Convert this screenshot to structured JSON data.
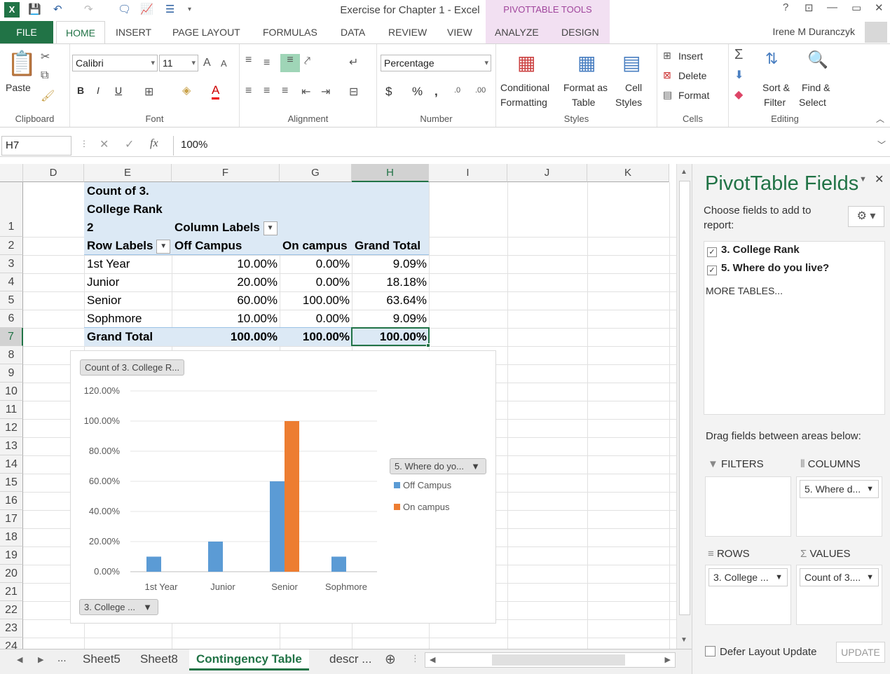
{
  "window": {
    "title": "Exercise for Chapter 1 - Excel",
    "context_tab": "PIVOTTABLE TOOLS",
    "user": "Irene M Duranczyk",
    "help": "?",
    "minimize": "—",
    "restore": "▭",
    "close": "✕"
  },
  "tabs": [
    "FILE",
    "HOME",
    "INSERT",
    "PAGE LAYOUT",
    "FORMULAS",
    "DATA",
    "REVIEW",
    "VIEW",
    "ANALYZE",
    "DESIGN"
  ],
  "ribbon": {
    "clipboard": {
      "paste": "Paste",
      "label": "Clipboard"
    },
    "font": {
      "name": "Calibri",
      "size": "11",
      "label": "Font",
      "bold": "B",
      "italic": "I",
      "underline": "U",
      "font_color": "A"
    },
    "alignment": {
      "label": "Alignment"
    },
    "number": {
      "format": "Percentage",
      "label": "Number",
      "currency": "$",
      "percent": "%",
      "comma": ","
    },
    "styles": {
      "conditional1": "Conditional",
      "conditional2": "Formatting",
      "format_as1": "Format as",
      "format_as2": "Table",
      "cell1": "Cell",
      "cell2": "Styles",
      "label": "Styles"
    },
    "cells": {
      "insert": "Insert",
      "delete": "Delete",
      "format": "Format",
      "label": "Cells"
    },
    "editing": {
      "sort1": "Sort &",
      "sort2": "Filter",
      "find1": "Find &",
      "find2": "Select",
      "label": "Editing"
    }
  },
  "formula_bar": {
    "name_box": "H7",
    "formula": "100%",
    "fx": "fx"
  },
  "columns": [
    "D",
    "E",
    "F",
    "G",
    "H",
    "I",
    "J",
    "K"
  ],
  "rows": [
    "1",
    "2",
    "3",
    "4",
    "5",
    "6",
    "7",
    "8",
    "9",
    "10",
    "11",
    "12",
    "13",
    "14",
    "15",
    "16",
    "17",
    "18",
    "19",
    "20",
    "21",
    "22",
    "23",
    "24"
  ],
  "pivot": {
    "title_line1": "Count of 3.",
    "title_line2": "College Rank",
    "title_line3": "2",
    "column_labels": "Column Labels",
    "row_labels": "Row Labels",
    "headers": [
      "Off Campus",
      "On campus",
      "Grand Total"
    ],
    "rows": [
      {
        "label": "1st Year",
        "off": "10.00%",
        "on": "0.00%",
        "total": "9.09%"
      },
      {
        "label": "Junior",
        "off": "20.00%",
        "on": "0.00%",
        "total": "18.18%"
      },
      {
        "label": "Senior",
        "off": "60.00%",
        "on": "100.00%",
        "total": "63.64%"
      },
      {
        "label": "Sophmore",
        "off": "10.00%",
        "on": "0.00%",
        "total": "9.09%"
      }
    ],
    "grand_total": {
      "label": "Grand Total",
      "off": "100.00%",
      "on": "100.00%",
      "total": "100.00%"
    }
  },
  "chart_data": {
    "type": "bar",
    "categories": [
      "1st Year",
      "Junior",
      "Senior",
      "Sophmore"
    ],
    "series": [
      {
        "name": "Off Campus",
        "color": "#5b9bd5",
        "values": [
          10,
          20,
          60,
          10
        ]
      },
      {
        "name": "On campus",
        "color": "#ed7d31",
        "values": [
          0,
          0,
          100,
          0
        ]
      }
    ],
    "y_ticks": [
      "0.00%",
      "20.00%",
      "40.00%",
      "60.00%",
      "80.00%",
      "100.00%",
      "120.00%"
    ],
    "ylim": [
      0,
      120
    ],
    "value_button": "Count of 3. College R...",
    "legend_button": "5. Where do yo...",
    "axis_button": "3. College ...",
    "legend_position": "right",
    "grid": true
  },
  "pane": {
    "title": "PivotTable Fields",
    "choose": "Choose fields to add to report:",
    "fields": [
      "3. College Rank",
      "5. Where do you live?"
    ],
    "more": "MORE TABLES...",
    "drag": "Drag fields between areas below:",
    "filters": "FILTERS",
    "columns": "COLUMNS",
    "rows": "ROWS",
    "values": "VALUES",
    "columns_item": "5. Where d...",
    "rows_item": "3. College ...",
    "values_item": "Count of 3....",
    "defer": "Defer Layout Update",
    "update": "UPDATE"
  },
  "sheet_tabs": [
    "Sheet5",
    "Sheet8",
    "Contingency Table",
    "descr ..."
  ],
  "sheet_more": "..."
}
